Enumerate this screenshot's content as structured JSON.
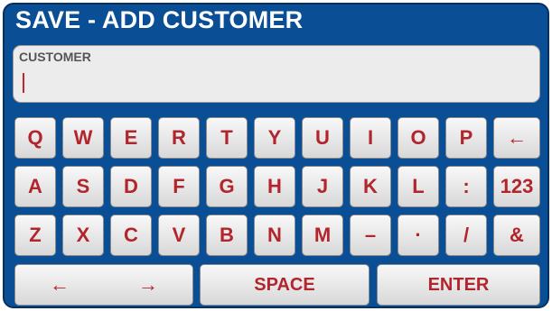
{
  "title": "SAVE - ADD CUSTOMER",
  "field": {
    "label": "CUSTOMER",
    "value": ""
  },
  "keyboard": {
    "row1": [
      "Q",
      "W",
      "E",
      "R",
      "T",
      "Y",
      "U",
      "I",
      "O",
      "P",
      "←"
    ],
    "row2": [
      "A",
      "S",
      "D",
      "F",
      "G",
      "H",
      "J",
      "K",
      "L",
      ":",
      "123"
    ],
    "row3": [
      "Z",
      "X",
      "C",
      "V",
      "B",
      "N",
      "M",
      "–",
      "·",
      "/",
      "&"
    ],
    "nav_left": "←",
    "nav_right": "→",
    "space": "SPACE",
    "enter": "ENTER"
  },
  "colors": {
    "panel_bg": "#0a4f95",
    "key_text": "#b2252c",
    "field_bg": "#ececec"
  }
}
